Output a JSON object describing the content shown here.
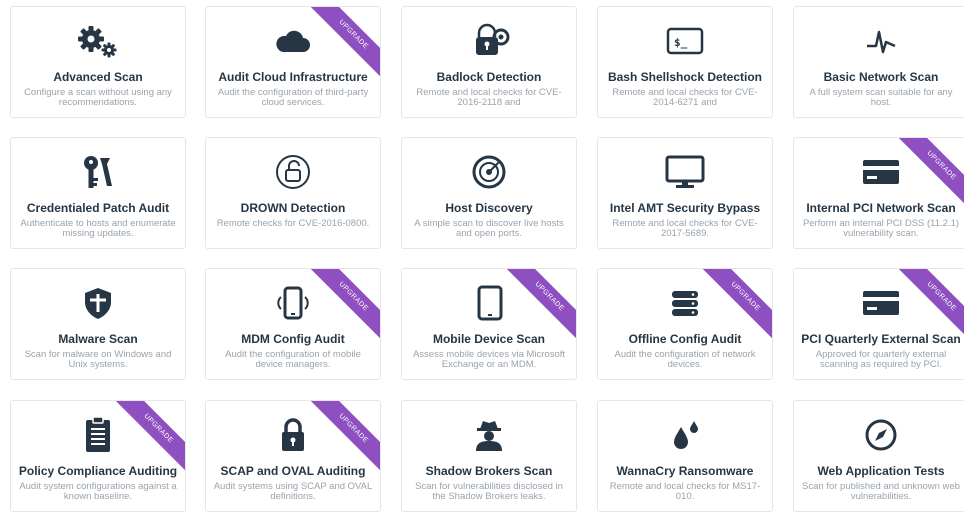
{
  "colors": {
    "icon": "#263645",
    "ribbon": "#8e4fc1",
    "title": "#263645",
    "desc": "#9aa3ab"
  },
  "templates": [
    {
      "title": "Advanced Scan",
      "desc": "Configure a scan without using any recommendations.",
      "icon": "gears-icon",
      "upgrade": false
    },
    {
      "title": "Audit Cloud Infrastructure",
      "desc": "Audit the configuration of third-party cloud services.",
      "icon": "cloud-icon",
      "upgrade": true,
      "ribbon": "UPGRADE"
    },
    {
      "title": "Badlock Detection",
      "desc": "Remote and local checks for CVE-2016-2118 and",
      "icon": "badlock-icon",
      "upgrade": false
    },
    {
      "title": "Bash Shellshock Detection",
      "desc": "Remote and local checks for CVE-2014-6271 and",
      "icon": "terminal-icon",
      "upgrade": false
    },
    {
      "title": "Basic Network Scan",
      "desc": "A full system scan suitable for any host.",
      "icon": "pulse-icon",
      "upgrade": false
    },
    {
      "title": "Credentialed Patch Audit",
      "desc": "Authenticate to hosts and enumerate missing updates.",
      "icon": "keys-icon",
      "upgrade": false
    },
    {
      "title": "DROWN Detection",
      "desc": "Remote checks for CVE-2016-0800.",
      "icon": "unlock-icon",
      "upgrade": false
    },
    {
      "title": "Host Discovery",
      "desc": "A simple scan to discover live hosts and open ports.",
      "icon": "radar-icon",
      "upgrade": false
    },
    {
      "title": "Intel AMT Security Bypass",
      "desc": "Remote and local checks for CVE-2017-5689.",
      "icon": "monitor-icon",
      "upgrade": false
    },
    {
      "title": "Internal PCI Network Scan",
      "desc": "Perform an internal PCI DSS (11.2.1) vulnerability scan.",
      "icon": "credit-card-icon",
      "upgrade": true,
      "ribbon": "UPGRADE"
    },
    {
      "title": "Malware Scan",
      "desc": "Scan for malware on Windows and Unix systems.",
      "icon": "shield-icon",
      "upgrade": false
    },
    {
      "title": "MDM Config Audit",
      "desc": "Audit the configuration of mobile device managers.",
      "icon": "mobile-icon",
      "upgrade": true,
      "ribbon": "UPGRADE"
    },
    {
      "title": "Mobile Device Scan",
      "desc": "Assess mobile devices via Microsoft Exchange or an MDM.",
      "icon": "tablet-icon",
      "upgrade": true,
      "ribbon": "UPGRADE"
    },
    {
      "title": "Offline Config Audit",
      "desc": "Audit the configuration of network devices.",
      "icon": "server-icon",
      "upgrade": true,
      "ribbon": "UPGRADE"
    },
    {
      "title": "PCI Quarterly External Scan",
      "desc": "Approved for quarterly external scanning as required by PCI.",
      "icon": "credit-card-icon",
      "upgrade": true,
      "ribbon": "UPGRADE"
    },
    {
      "title": "Policy Compliance Auditing",
      "desc": "Audit system configurations against a known baseline.",
      "icon": "clipboard-icon",
      "upgrade": true,
      "ribbon": "UPGRADE"
    },
    {
      "title": "SCAP and OVAL Auditing",
      "desc": "Audit systems using SCAP and OVAL definitions.",
      "icon": "lock-icon",
      "upgrade": true,
      "ribbon": "UPGRADE"
    },
    {
      "title": "Shadow Brokers Scan",
      "desc": "Scan for vulnerabilities disclosed in the Shadow Brokers leaks.",
      "icon": "spy-icon",
      "upgrade": false
    },
    {
      "title": "WannaCry Ransomware",
      "desc": "Remote and local checks for MS17-010.",
      "icon": "drops-icon",
      "upgrade": false
    },
    {
      "title": "Web Application Tests",
      "desc": "Scan for published and unknown web vulnerabilities.",
      "icon": "compass-icon",
      "upgrade": false
    }
  ]
}
